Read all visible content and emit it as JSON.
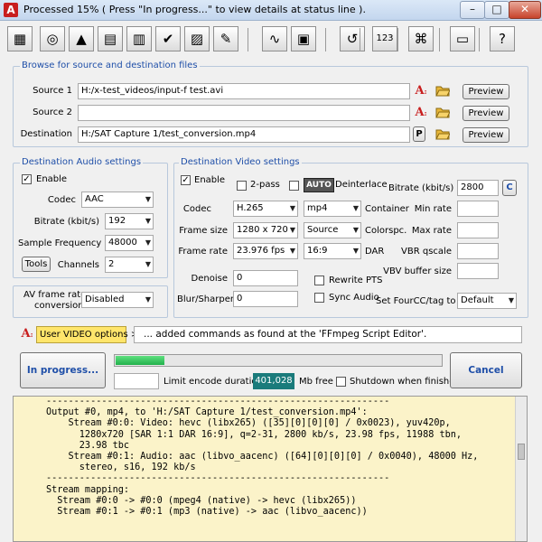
{
  "window": {
    "title": "Processed 15%  ( Press \"In progress...\" to view details at status line ).",
    "min": "–",
    "max": "□",
    "close": "✕"
  },
  "toolbar": {
    "buttons": [
      {
        "name": "settings-window-icon",
        "glyph": "▦"
      },
      {
        "name": "disc-refresh-icon",
        "glyph": "◎"
      },
      {
        "name": "palette-icon",
        "glyph": "▲"
      },
      {
        "name": "film-strip-icon",
        "glyph": "▤"
      },
      {
        "name": "film-storyboard-icon",
        "glyph": "▥"
      },
      {
        "name": "film-check-icon",
        "glyph": "✔"
      },
      {
        "name": "pattern-icon",
        "glyph": "▨"
      },
      {
        "name": "notepad-icon",
        "glyph": "✎"
      },
      {
        "name": "waveform-icon",
        "glyph": "∿"
      },
      {
        "name": "film-edit-icon",
        "glyph": "▣"
      },
      {
        "name": "back-arrow-icon",
        "glyph": "↺"
      },
      {
        "name": "calculator-icon",
        "glyph": "123"
      },
      {
        "name": "network-icon",
        "glyph": "⌘"
      },
      {
        "name": "monitor-icon",
        "glyph": "▭"
      },
      {
        "name": "help-icon",
        "glyph": "?"
      }
    ]
  },
  "browse": {
    "heading": "Browse for source and destination files",
    "source1_label": "Source 1",
    "source1_value": "H:/x-test_videos/input-f test.avi",
    "source2_label": "Source 2",
    "source2_value": "",
    "dest_label": "Destination",
    "dest_value": "H:/SAT Capture 1/test_conversion.mp4",
    "preview": "Preview",
    "p_button": "P"
  },
  "audio": {
    "heading": "Destination Audio settings",
    "enable": "Enable",
    "codec_label": "Codec",
    "codec": "AAC",
    "bitrate_label": "Bitrate (kbit/s)",
    "bitrate": "192",
    "samplefreq_label": "Sample Frequency",
    "samplefreq": "48000",
    "tools": "Tools",
    "channels_label": "Channels",
    "channels": "2",
    "avframe_label1": "AV frame rate",
    "avframe_label2": "conversion",
    "avframe": "Disabled"
  },
  "video": {
    "heading": "Destination Video settings",
    "enable": "Enable",
    "twopass": "2-pass",
    "auto": "AUTO",
    "deinterlace": "Deinterlace",
    "bitrate_label": "Bitrate (kbit/s)",
    "bitrate": "2800",
    "c_button": "C",
    "codec_label": "Codec",
    "codec": "H.265",
    "container": "mp4",
    "container_label": "Container",
    "minrate_label": "Min rate",
    "framesize_label": "Frame size",
    "framesize": "1280 x 720",
    "colorspc": "Source",
    "colorspc_label": "Colorspc.",
    "maxrate_label": "Max rate",
    "framerate_label": "Frame rate",
    "framerate": "23.976 fps",
    "dar": "16:9",
    "dar_label": "DAR",
    "vbrq_label": "VBR qscale",
    "vbvbuf_label": "VBV buffer size",
    "denoise_label": "Denoise",
    "denoise": "0",
    "rewrite": "Rewrite PTS",
    "blur_label": "Blur/Sharpen",
    "blur": "0",
    "syncaudio": "Sync Audio",
    "fourcc_label": "Set FourCC/tag to",
    "fourcc": "Default"
  },
  "options": {
    "user_video": "User VIDEO options >",
    "note": "... added commands as found at the 'FFmpeg Script Editor'."
  },
  "progress": {
    "inprogress": "In progress...",
    "percent": 0.15,
    "limit_label": "Limit encode duration",
    "free_value": "401,028",
    "free_label": "Mb free",
    "shutdown": "Shutdown when finished",
    "cancel": "Cancel"
  },
  "log": {
    "text": "--------------------------------------------------------------\nOutput #0, mp4, to 'H:/SAT Capture 1/test_conversion.mp4':\n    Stream #0:0: Video: hevc (libx265) ([35][0][0][0] / 0x0023), yuv420p,\n      1280x720 [SAR 1:1 DAR 16:9], q=2-31, 2800 kb/s, 23.98 fps, 11988 tbn,\n      23.98 tbc\n    Stream #0:1: Audio: aac (libvo_aacenc) ([64][0][0][0] / 0x0040), 48000 Hz,\n      stereo, s16, 192 kb/s\n--------------------------------------------------------------\nStream mapping:\n  Stream #0:0 -> #0:0 (mpeg4 (native) -> hevc (libx265))\n  Stream #0:1 -> #0:1 (mp3 (native) -> aac (libvo_aacenc))"
  },
  "colors": {
    "accent_blue": "#1f4fa8",
    "progress_green": "#22b14c",
    "free_teal": "#1a7b7b",
    "log_bg": "#fbf3c9",
    "user_opt_bg": "#ffe56b"
  }
}
